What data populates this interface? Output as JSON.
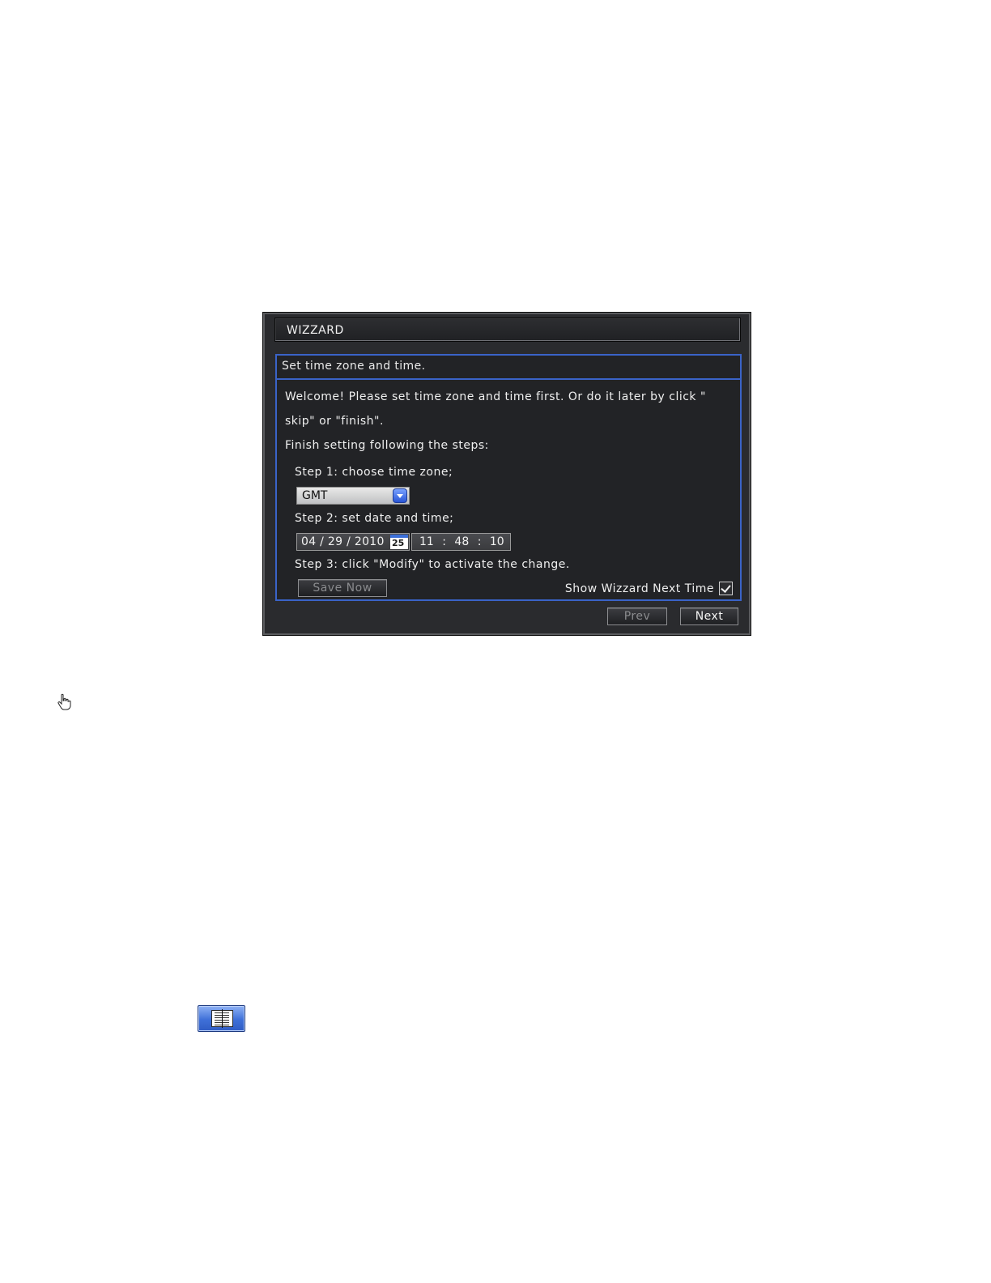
{
  "wizard": {
    "title": "WIZZARD",
    "subtitle": "Set time zone and time.",
    "intro_line1": "Welcome! Please set time zone and time first. Or do it later by click \"",
    "intro_line2": "skip\" or \"finish\".",
    "steps_heading": "Finish setting following the steps:",
    "step1": "Step 1: choose time zone;",
    "timezone": "GMT",
    "step2": "Step 2: set date and time;",
    "date": "04 / 29 / 2010",
    "calendar_day": "25",
    "time": "11 : 48 : 10",
    "step3": "Step 3: click \"Modify\" to activate the change.",
    "save_label": "Save Now",
    "show_next_label": "Show Wizzard Next Time",
    "show_next_checked": true,
    "prev_label": "Prev",
    "next_label": "Next"
  },
  "icons": {
    "cursor": "hand-cursor-icon",
    "manual": "book-icon"
  },
  "colors": {
    "frame_border": "#3a63c8",
    "panel_bg": "#222326",
    "dropdown_arrow": "#2a56d6"
  }
}
